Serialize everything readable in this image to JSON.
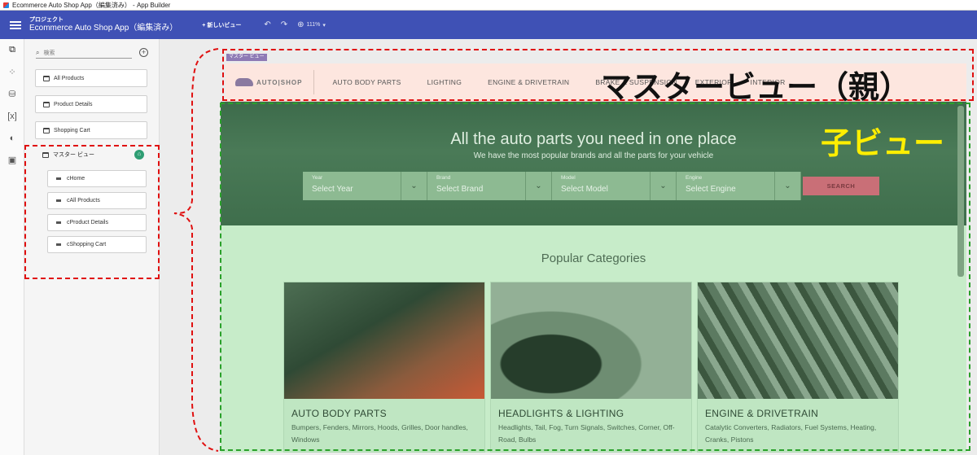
{
  "window": {
    "title": "Ecommerce Auto Shop App（編集済み） - App Builder"
  },
  "header": {
    "project_label": "プロジェクト",
    "project_name": "Ecommerce Auto Shop App（編集済み）",
    "new_view": "+ 新しいビュー",
    "zoom": "111%"
  },
  "tree": {
    "search_placeholder": "検索",
    "pages": [
      "All Products",
      "Product Details",
      "Shopping Cart"
    ],
    "master": "マスター ビュー",
    "children": [
      "cHome",
      "cAll Products",
      "cProduct Details",
      "cShopping Cart"
    ]
  },
  "master_view": {
    "tag": "マスター ビュー",
    "logo": "AUTO|SHOP",
    "nav": [
      "AUTO BODY PARTS",
      "LIGHTING",
      "ENGINE & DRIVETRAIN",
      "BRAKE & SUSPENSION",
      "EXTERIOR",
      "INTERIOR"
    ]
  },
  "child_view": {
    "hero_title": "All the auto parts you need in one place",
    "hero_subtitle": "We have the most popular brands and all the parts for your vehicle",
    "selects": [
      {
        "label": "Year",
        "value": "Select Year"
      },
      {
        "label": "Brand",
        "value": "Select Brand"
      },
      {
        "label": "Model",
        "value": "Select Model"
      },
      {
        "label": "Engine",
        "value": "Select Engine"
      }
    ],
    "search_button": "SEARCH",
    "popular_title": "Popular Categories",
    "cards": [
      {
        "title": "AUTO BODY PARTS",
        "desc": "Bumpers, Fenders, Mirrors, Hoods, Grilles, Door handles, Windows"
      },
      {
        "title": "HEADLIGHTS & LIGHTING",
        "desc": "Headlights, Tail, Fog, Turn Signals, Switches, Corner, Off-Road, Bulbs"
      },
      {
        "title": "ENGINE & DRIVETRAIN",
        "desc": "Catalytic Converters, Radiators, Fuel Systems, Heating, Cranks, Pistons"
      }
    ]
  },
  "annotations": {
    "master_label": "マスタービュー（親）",
    "child_label": "子ビュー",
    "red": "#e01010",
    "green": "#2aa02a",
    "yellow": "#ffee00"
  }
}
